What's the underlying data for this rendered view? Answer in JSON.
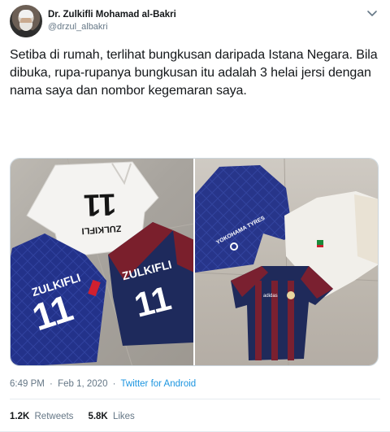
{
  "author": {
    "display_name": "Dr. Zulkifli Mohamad al-Bakri",
    "handle": "@drzul_albakri"
  },
  "tweet": {
    "text": "Setiba di rumah, terlihat bungkusan daripada Istana Negara. Bila dibuka, rupa-rupanya bungkusan itu adalah 3 helai jersi dengan nama saya dan nombor kegemaran saya."
  },
  "media": {
    "left_photo": {
      "jersey_top": {
        "name": "ZULKIFLI",
        "number": "11"
      },
      "jersey_left": {
        "name": "ZULKIFLI",
        "number": "11"
      },
      "jersey_right": {
        "name": "ZULKIFLI",
        "number": "11"
      }
    },
    "right_photo": {
      "jersey_blue_text": "YOKOHAMA TYRES",
      "jersey_blue_badge": "adidas"
    }
  },
  "meta": {
    "time": "6:49 PM",
    "separator": "·",
    "date": "Feb 1, 2020",
    "source": "Twitter for Android"
  },
  "stats": {
    "retweets_count": "1.2K",
    "retweets_label": "Retweets",
    "likes_count": "5.8K",
    "likes_label": "Likes"
  },
  "icons": {
    "chevron": "chevron-down-icon"
  }
}
